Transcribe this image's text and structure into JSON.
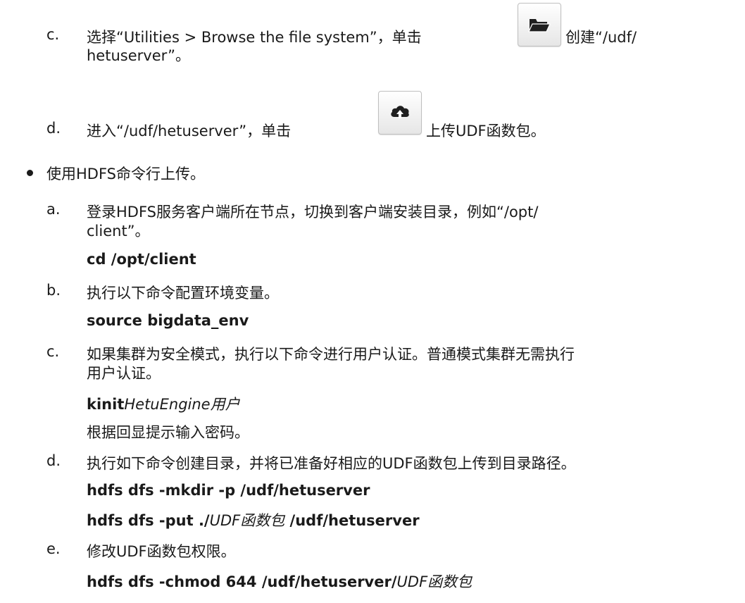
{
  "steps_web": {
    "c": {
      "marker": "c.",
      "before_icon": "选择“Utilities > Browse the file system”，单击",
      "after_icon": "创建“/udf/",
      "line2": "hetuserver”。",
      "icon": "folder-open-icon"
    },
    "d": {
      "marker": "d.",
      "before_icon": "进入“/udf/hetuserver”，单击",
      "after_icon": "上传UDF函数包。",
      "icon": "cloud-upload-icon"
    }
  },
  "bullet_hdfs": {
    "text": "使用HDFS命令行上传。"
  },
  "steps_cli": {
    "a": {
      "marker": "a.",
      "line1": "登录HDFS服务客户端所在节点，切换到客户端安装目录，例如“/opt/",
      "line2": "client”。",
      "command": "cd /opt/client"
    },
    "b": {
      "marker": "b.",
      "text": "执行以下命令配置环境变量。",
      "command": "source bigdata_env"
    },
    "c": {
      "marker": "c.",
      "line1": "如果集群为安全模式，执行以下命令进行用户认证。普通模式集群无需执行",
      "line2": "用户认证。",
      "command_bold": "kinit",
      "command_italic": "HetuEngine用户",
      "note": "根据回显提示输入密码。"
    },
    "d": {
      "marker": "d.",
      "text": "执行如下命令创建目录，并将已准备好相应的UDF函数包上传到目录路径。",
      "command1": "hdfs dfs -mkdir -p /udf/hetuserver",
      "command2_a": "hdfs dfs -put ./",
      "command2_italic": "UDF函数包",
      "command2_b": " /udf/hetuserver"
    },
    "e": {
      "marker": "e.",
      "text": "修改UDF函数包权限。",
      "command_bold": "hdfs dfs -chmod 644 /udf/hetuserver/",
      "command_italic": "UDF函数包"
    }
  }
}
